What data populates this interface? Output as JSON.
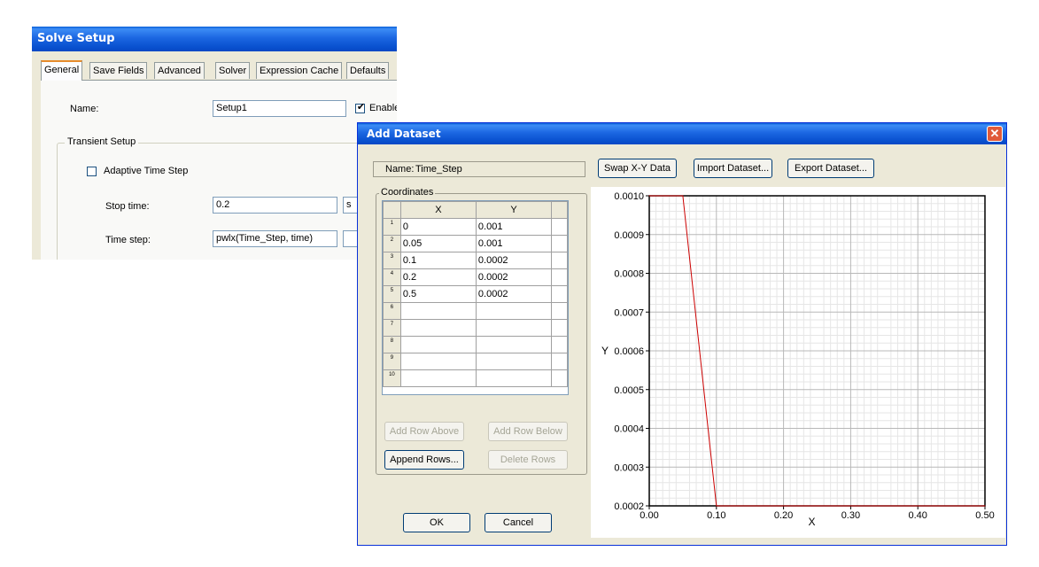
{
  "solve_setup": {
    "title": "Solve Setup",
    "tabs": [
      "General",
      "Save Fields",
      "Advanced",
      "Solver",
      "Expression Cache",
      "Defaults"
    ],
    "name_label": "Name:",
    "name_value": "Setup1",
    "enable_label": "Enable",
    "transient_group": "Transient Setup",
    "adaptive_label": "Adaptive Time Step",
    "stop_time_label": "Stop time:",
    "stop_time_value": "0.2",
    "stop_time_unit": "s",
    "time_step_label": "Time step:",
    "time_step_value": "pwlx(Time_Step, time)"
  },
  "add_dataset": {
    "title": "Add Dataset",
    "name_label": "Name:",
    "name_value": "Time_Step",
    "buttons": {
      "swap": "Swap X-Y Data",
      "import": "Import Dataset...",
      "export": "Export Dataset...",
      "add_above": "Add Row Above",
      "add_below": "Add Row Below",
      "append": "Append Rows...",
      "delete": "Delete Rows",
      "ok": "OK",
      "cancel": "Cancel"
    },
    "coordinates_label": "Coordinates",
    "columns": [
      "X",
      "Y"
    ],
    "rows": [
      {
        "n": "1",
        "x": "0",
        "y": "0.001"
      },
      {
        "n": "2",
        "x": "0.05",
        "y": "0.001"
      },
      {
        "n": "3",
        "x": "0.1",
        "y": "0.0002"
      },
      {
        "n": "4",
        "x": "0.2",
        "y": "0.0002"
      },
      {
        "n": "5",
        "x": "0.5",
        "y": "0.0002"
      },
      {
        "n": "6",
        "x": "",
        "y": ""
      },
      {
        "n": "7",
        "x": "",
        "y": ""
      },
      {
        "n": "8",
        "x": "",
        "y": ""
      },
      {
        "n": "9",
        "x": "",
        "y": ""
      },
      {
        "n": "10",
        "x": "",
        "y": ""
      }
    ]
  },
  "chart_data": {
    "type": "line",
    "xlabel": "X",
    "ylabel": "Y",
    "xlim": [
      0,
      0.5
    ],
    "ylim": [
      0.0002,
      0.001
    ],
    "x_ticks": [
      "0.00",
      "0.10",
      "0.20",
      "0.30",
      "0.40",
      "0.50"
    ],
    "y_ticks": [
      "0.0010",
      "0.0009",
      "0.0008",
      "0.0007",
      "0.0006",
      "0.0005",
      "0.0004",
      "0.0003",
      "0.0002"
    ],
    "grid": true,
    "series": [
      {
        "color": "#cc0000",
        "x": [
          0,
          0.05,
          0.1,
          0.2,
          0.5
        ],
        "y": [
          0.001,
          0.001,
          0.0002,
          0.0002,
          0.0002
        ]
      }
    ]
  }
}
